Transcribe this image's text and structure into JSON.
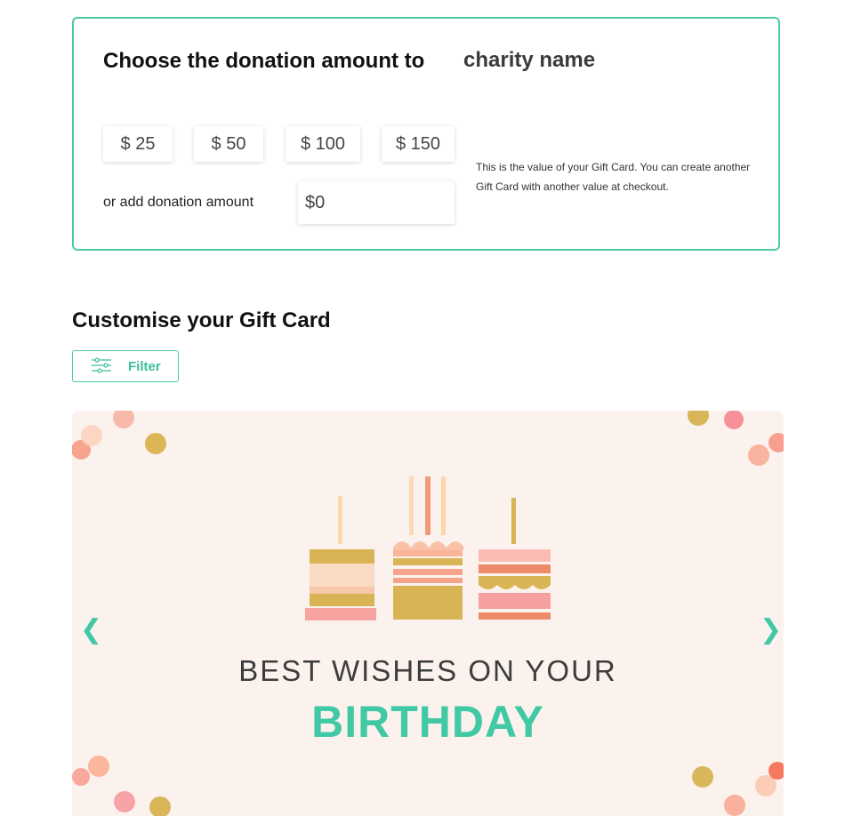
{
  "donation": {
    "title": "Choose the donation amount to",
    "charity_name": "charity name",
    "amounts": [
      "$ 25",
      "$ 50",
      "$ 100",
      "$ 150"
    ],
    "or_label": "or add donation amount",
    "input_value": "$0",
    "info_text": "This is the value of your Gift Card. You can create another Gift Card with another value at checkout."
  },
  "customise": {
    "title": "Customise your Gift Card",
    "filter_label": "Filter"
  },
  "card": {
    "line1": "BEST WISHES ON YOUR",
    "line2": "BIRTHDAY",
    "prev_arrow": "❮",
    "next_arrow": "❯"
  },
  "colors": {
    "accent": "#40c9a4",
    "card_background": "#fbf2ee"
  }
}
